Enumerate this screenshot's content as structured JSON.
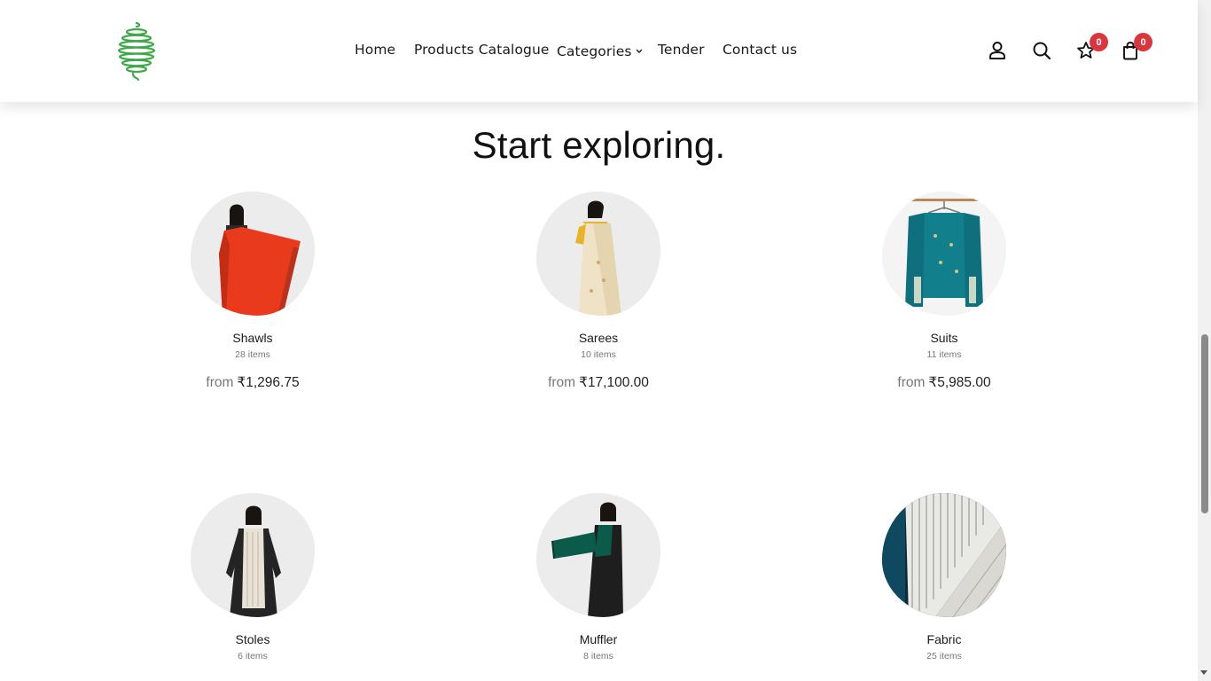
{
  "header": {
    "logo_icon": "green-spiral-globe-logo",
    "nav": {
      "home": "Home",
      "catalogue": "Products Catalogue",
      "categories": "Categories",
      "tender": "Tender",
      "contact": "Contact us"
    },
    "icons": {
      "account": "user-icon",
      "search": "search-icon",
      "wishlist": "star-icon",
      "cart": "shopping-bag-icon"
    },
    "wishlist_count": "0",
    "cart_count": "0",
    "badge_color": "#d9363e"
  },
  "main": {
    "title": "Start exploring.",
    "price_prefix": "from",
    "categories": [
      {
        "name": "Shawls",
        "count": "28 items",
        "price": "₹1,296.75"
      },
      {
        "name": "Sarees",
        "count": "10 items",
        "price": "₹17,100.00"
      },
      {
        "name": "Suits",
        "count": "11 items",
        "price": "₹5,985.00"
      },
      {
        "name": "Stoles",
        "count": "6 items"
      },
      {
        "name": "Muffler",
        "count": "8 items"
      },
      {
        "name": "Fabric",
        "count": "25 items"
      }
    ]
  },
  "colors": {
    "logo_green": "#3ea84a",
    "accent_text": "#1a1a1a"
  }
}
